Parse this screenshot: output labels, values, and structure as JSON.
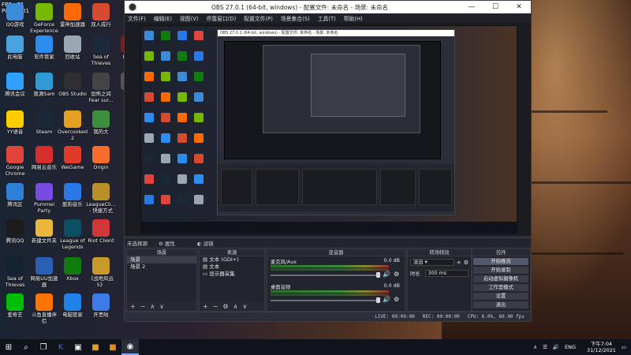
{
  "fps": {
    "line1": "FPS : 71",
    "line2": "Ping : 101"
  },
  "desktop_icons": [
    {
      "label": "QQ游戏",
      "icon": "qq-game-icon",
      "color": "#3b8bd9"
    },
    {
      "label": "GeForce Experience",
      "icon": "geforce-icon",
      "color": "#76b900"
    },
    {
      "label": "雷神加速器",
      "icon": "leishen-icon",
      "color": "#ff6a00"
    },
    {
      "label": "双人成行",
      "icon": "ittakestwo-icon",
      "color": "#d84a2f"
    },
    {
      "label": "Epic",
      "icon": "epic-icon",
      "color": "#222222"
    },
    {
      "label": "此电脑",
      "icon": "computer-icon",
      "color": "#4aa3df"
    },
    {
      "label": "软件管家",
      "icon": "software-icon",
      "color": "#2d8cf0"
    },
    {
      "label": "回收站",
      "icon": "recycle-icon",
      "color": "#9aa7b3"
    },
    {
      "label": "Sea of Thieves",
      "icon": "sea-of-thieves-icon",
      "color": "#1b2a3a"
    },
    {
      "label": "Dead",
      "icon": "dead-icon",
      "color": "#7a1d1d"
    },
    {
      "label": "腾讯会议",
      "icon": "tencent-meeting-icon",
      "color": "#2fa0ff"
    },
    {
      "label": "兽源Sam",
      "icon": "sam-icon",
      "color": "#2e9ad6"
    },
    {
      "label": "OBS Studio",
      "icon": "obs-icon",
      "color": "#302e31"
    },
    {
      "label": "恐怖之间 Fear sur...",
      "icon": "fear-icon",
      "color": "#444444"
    },
    {
      "label": "Pe",
      "icon": "pe-icon",
      "color": "#555555"
    },
    {
      "label": "YY语音",
      "icon": "yy-icon",
      "color": "#ffcc00"
    },
    {
      "label": "Steam",
      "icon": "steam-icon",
      "color": "#1b2838"
    },
    {
      "label": "Overcooked 2",
      "icon": "overcooked-icon",
      "color": "#e4a020"
    },
    {
      "label": "我的大",
      "icon": "wodedai-icon",
      "color": "#3d8f3d"
    },
    {
      "label": "Google Chrome",
      "icon": "chrome-icon",
      "color": "#e0443a"
    },
    {
      "label": "网易云音乐",
      "icon": "netease-music-icon",
      "color": "#d82d2d"
    },
    {
      "label": "WeGame",
      "icon": "wegame-icon",
      "color": "#e23a2a"
    },
    {
      "label": "Origin",
      "icon": "origin-icon",
      "color": "#f56c2d"
    },
    {
      "label": "腾讯区",
      "icon": "tencent-icon",
      "color": "#2f7fd9"
    },
    {
      "label": "Pummel Party",
      "icon": "pummel-party-icon",
      "color": "#7a4be0"
    },
    {
      "label": "酷狗音乐",
      "icon": "kugou-icon",
      "color": "#2a78e6"
    },
    {
      "label": "LeagueCli... - 快捷方式",
      "icon": "league-client-icon",
      "color": "#b8902a"
    },
    {
      "label": "腾讯QQ",
      "icon": "qq-icon",
      "color": "#1c1c1c"
    },
    {
      "label": "新建文件夹",
      "icon": "folder-icon",
      "color": "#e8b73c"
    },
    {
      "label": "League of Legends",
      "icon": "lol-icon",
      "color": "#0a4f62"
    },
    {
      "label": "Riot Client",
      "icon": "riot-icon",
      "color": "#d13639"
    },
    {
      "label": "Sea of Thieves",
      "icon": "sea-of-thieves-icon",
      "color": "#142333"
    },
    {
      "label": "网易UU加速器",
      "icon": "uu-icon",
      "color": "#2a5fb4"
    },
    {
      "label": "Xbox",
      "icon": "xbox-icon",
      "color": "#107c10"
    },
    {
      "label": "《战地风云 5》",
      "icon": "bf5-icon",
      "color": "#c79a2a"
    },
    {
      "label": "爱奇艺",
      "icon": "iqiyi-icon",
      "color": "#00be06"
    },
    {
      "label": "斗鱼直播伴侣",
      "icon": "douyu-icon",
      "color": "#ff7500"
    },
    {
      "label": "电脑管家",
      "icon": "pc-manager-icon",
      "color": "#1e82e8"
    },
    {
      "label": "开黑啦",
      "icon": "kaiheila-icon",
      "color": "#3b7ce6"
    }
  ],
  "obs": {
    "title": "OBS 27.0.1 (64-bit, windows) - 配置文件: 未命名 - 场景: 未命名",
    "menu": [
      "文件(F)",
      "编辑(E)",
      "视图(V)",
      "停靠窗口(D)",
      "配置文件(P)",
      "场景集合(S)",
      "工具(T)",
      "帮助(H)"
    ],
    "tabs": [
      "未选择源",
      "属性",
      "滤镜"
    ],
    "scenes": {
      "header": "场景",
      "items": [
        "场景",
        "场景 2"
      ]
    },
    "sources": {
      "header": "来源",
      "items": [
        "文本 (GDI+)",
        "文本",
        "显示器采集"
      ]
    },
    "mixer": {
      "header": "混音器",
      "channels": [
        {
          "name": "麦克风/Aux",
          "db": "0.0 dB"
        },
        {
          "name": "桌面音频",
          "db": "0.0 dB"
        }
      ]
    },
    "transitions": {
      "header": "转场特效",
      "type": "淡出",
      "duration_label": "时长",
      "duration_value": "300 ms"
    },
    "controls": {
      "header": "控件",
      "buttons": [
        "开始推流",
        "开始录制",
        "启动虚拟摄像机",
        "工作室模式",
        "设置",
        "退出"
      ]
    },
    "status": {
      "live": "LIVE: 00:00:00",
      "rec": "REC: 00:00:00",
      "cpu": "CPU: 6.0%, 60.00 fps"
    }
  },
  "taskbar": {
    "lang": "ENG",
    "time": "下午7:04",
    "date": "31/12/2021"
  }
}
